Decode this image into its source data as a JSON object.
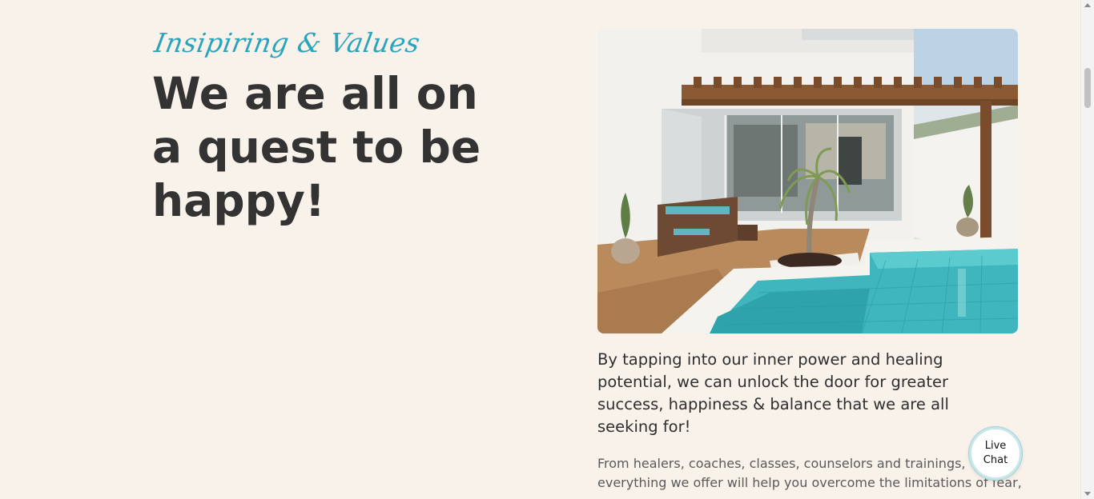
{
  "section": {
    "eyebrow": "Insipiring & Values",
    "headline": "We are all on a quest to be happy!",
    "lead": "By tapping into our inner power and healing potential, we can unlock the door for greater success, happiness & balance that we are all seeking for!",
    "body": "From healers, coaches, classes, counselors and trainings, everything we offer will help you overcome the limitations of fear,"
  },
  "image": {
    "subject": "modern house patio with wooden pergola, wicker sofa, potted palms and turquoise tiled pool"
  },
  "live_chat": {
    "label": "Live Chat"
  },
  "colors": {
    "background": "#f8f2ea",
    "accent": "#2aa4bd",
    "heading": "#333333",
    "pool": "#3fb6bd",
    "wood": "#8a5a35"
  }
}
